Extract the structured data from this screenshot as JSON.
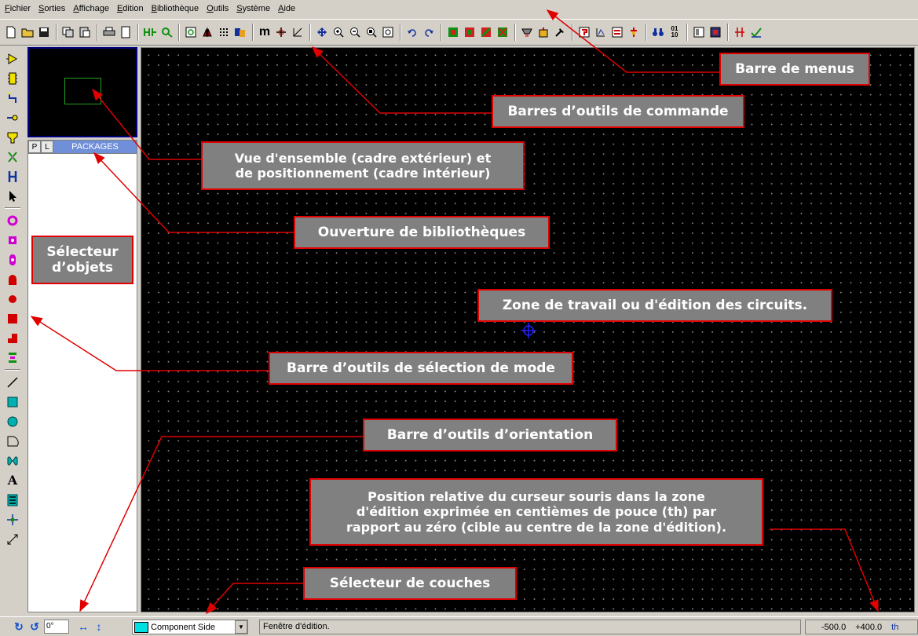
{
  "menubar": {
    "items": [
      "Fichier",
      "Sorties",
      "Affichage",
      "Edition",
      "Bibliothèque",
      "Outils",
      "Système",
      "Aide"
    ]
  },
  "library": {
    "tab_p": "P",
    "tab_l": "L",
    "title": "PACKAGES"
  },
  "status": {
    "angle": "0°",
    "layer": "Component Side",
    "message": "Fenêtre d'édition.",
    "coord_x": "-500.0",
    "coord_y": "+400.0",
    "unit": "th"
  },
  "annotations": {
    "menubar": "Barre de menus",
    "command_toolbars": "Barres d’outils de commande",
    "overview_line1": "Vue d'ensemble (cadre extérieur) et",
    "overview_line2": "de positionnement (cadre intérieur)",
    "libraries": "Ouverture de bibliothèques",
    "selector_line1": "Sélecteur",
    "selector_line2": "d’objets",
    "work_zone": "Zone de travail ou d'édition des circuits.",
    "mode_toolbar": "Barre d’outils de sélection de mode",
    "orientation_toolbar": "Barre d’outils d’orientation",
    "position_line1": "Position relative du curseur souris dans la zone",
    "position_line2": "d'édition exprimée en centièmes de pouce (th) par",
    "position_line3": "rapport au zéro (cible au centre de la zone d'édition).",
    "layer_selector": "Sélecteur de couches"
  },
  "colors": {
    "annotation_bg": "#808080",
    "annotation_border": "#e00000",
    "canvas_bg": "#000000",
    "library_title_bg": "#6f8fd8"
  }
}
